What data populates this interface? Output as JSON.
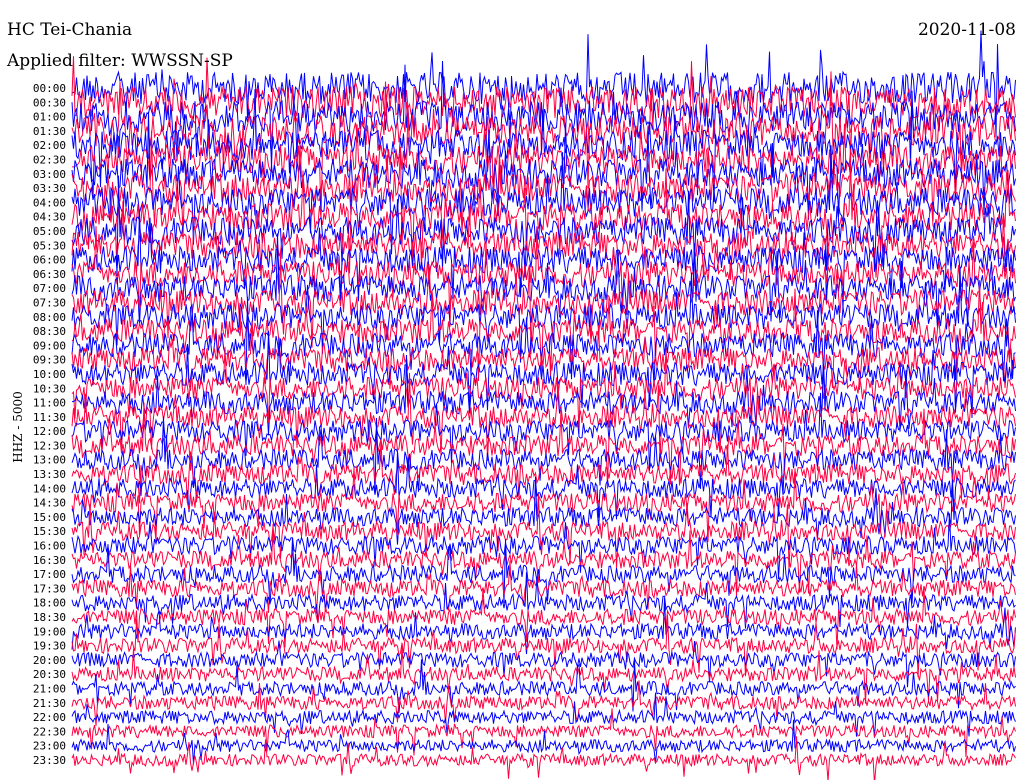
{
  "header": {
    "station": "HC Tei-Chania",
    "filter": "Applied filter: WWSSN-SP",
    "date": "2020-11-08"
  },
  "chart_data": {
    "type": "line",
    "title": "HC Tei-Chania",
    "ylabel": "HHZ - 5000",
    "row_labels": [
      "00:00",
      "00:30",
      "01:00",
      "01:30",
      "02:00",
      "02:30",
      "03:00",
      "03:30",
      "04:00",
      "04:30",
      "05:00",
      "05:30",
      "06:00",
      "06:30",
      "07:00",
      "07:30",
      "08:00",
      "08:30",
      "09:00",
      "09:30",
      "10:00",
      "10:30",
      "11:00",
      "11:30",
      "12:00",
      "12:30",
      "13:00",
      "13:30",
      "14:00",
      "14:30",
      "15:00",
      "15:30",
      "16:00",
      "16:30",
      "17:00",
      "17:30",
      "18:00",
      "18:30",
      "19:00",
      "19:30",
      "20:00",
      "20:30",
      "21:00",
      "21:30",
      "22:00",
      "22:30",
      "23:00",
      "23:30"
    ],
    "series_colors": [
      "#0000ff",
      "#ff0040"
    ],
    "grid": false
  }
}
